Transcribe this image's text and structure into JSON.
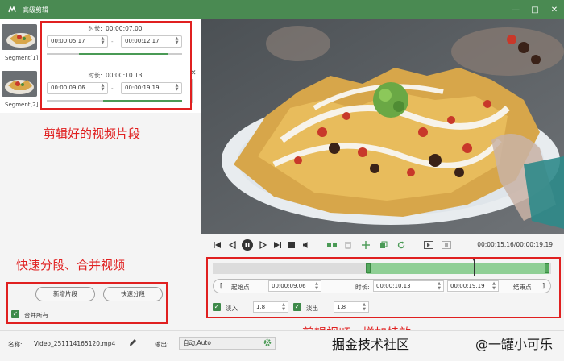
{
  "window": {
    "title": "高级剪辑"
  },
  "segments": [
    {
      "label": "Segment[1]",
      "duration_label": "时长:",
      "duration": "00:00:07.00",
      "start": "00:00:05.17",
      "end": "00:00:12.17",
      "separator": "-"
    },
    {
      "label": "Segment[2]",
      "duration_label": "时长:",
      "duration": "00:00:10.13",
      "start": "00:00:09.06",
      "end": "00:00:19.19",
      "separator": "-"
    }
  ],
  "annotations": {
    "segments_note": "剪辑好的视频片段",
    "buttons_note": "快速分段、合并视频",
    "editor_note": "剪辑视频，增加特效"
  },
  "left_buttons": {
    "add_segment": "新增片段",
    "quick_split": "快速分段"
  },
  "merge_all": {
    "label": "合并所有",
    "checked": true
  },
  "transport": {
    "time_current": "00:00:15.16",
    "time_total": "00:00:19.19",
    "time_sep": "/"
  },
  "editor": {
    "range_start_bracket": "[",
    "start_label": "起始点",
    "start_value": "00:00:09.06",
    "duration_label": "时长:",
    "duration_value": "00:00:10.13",
    "end_value": "00:00:19.19",
    "end_label": "结束点",
    "range_end_bracket": "]",
    "fade_in": {
      "label": "淡入",
      "value": "1.8",
      "checked": true
    },
    "fade_out": {
      "label": "淡出",
      "value": "1.8",
      "checked": true
    }
  },
  "bottom": {
    "name_label": "名称:",
    "name_value": "Video_251114165120.mp4",
    "output_label": "输出:",
    "output_value": "自动;Auto"
  },
  "watermark": {
    "text_a": "掘金技术社区",
    "text_b": "@一罐小可乐"
  },
  "colors": {
    "accent": "#4a8a52",
    "annotation": "#e02020",
    "timeline_sel": "#8fcf95"
  }
}
